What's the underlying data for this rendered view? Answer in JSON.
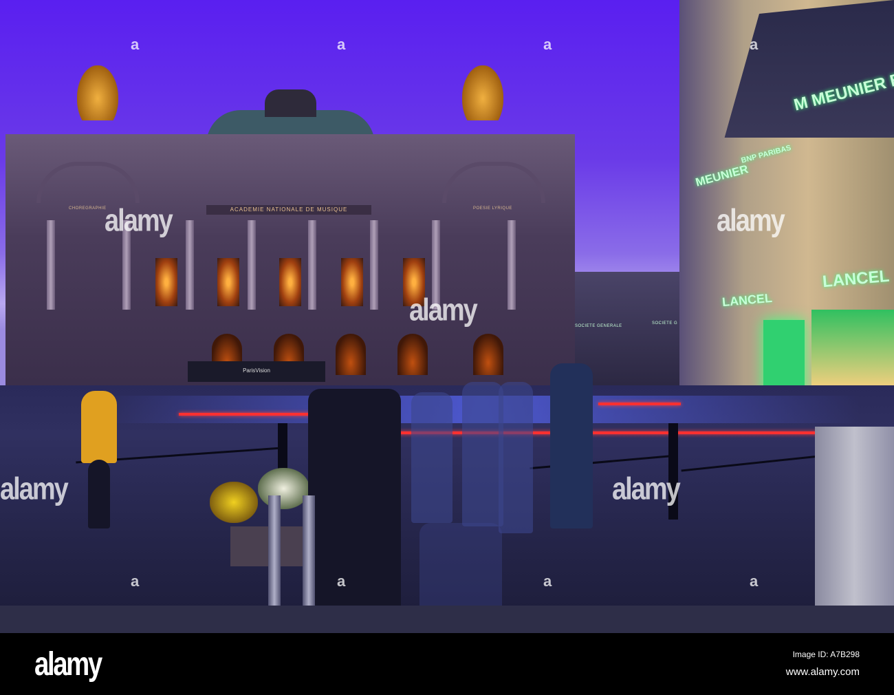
{
  "photo": {
    "subject": "Palais Garnier opera house at dusk",
    "facade_inscription": "ACADEMIE NATIONALE DE MUSIQUE",
    "facade_left_label": "CHOREGRAPHIE",
    "facade_right_label": "POESIE LYRIQUE",
    "bus_sign": "ParisVision",
    "signs": {
      "meunier_top": "M MEUNIER B",
      "meunier_lower": "MEUNIER",
      "bnp": "BNP PARIBAS",
      "lancel_left": "LANCEL",
      "lancel_right": "LANCEL",
      "societe_generale_1": "SOCIETE GENERALE",
      "societe_generale_2": "SOCIETE G"
    },
    "watermark_big": "alamy",
    "watermark_small": "a"
  },
  "footer": {
    "logo": "alamy",
    "image_id": "Image ID: A7B298",
    "url": "www.alamy.com"
  }
}
